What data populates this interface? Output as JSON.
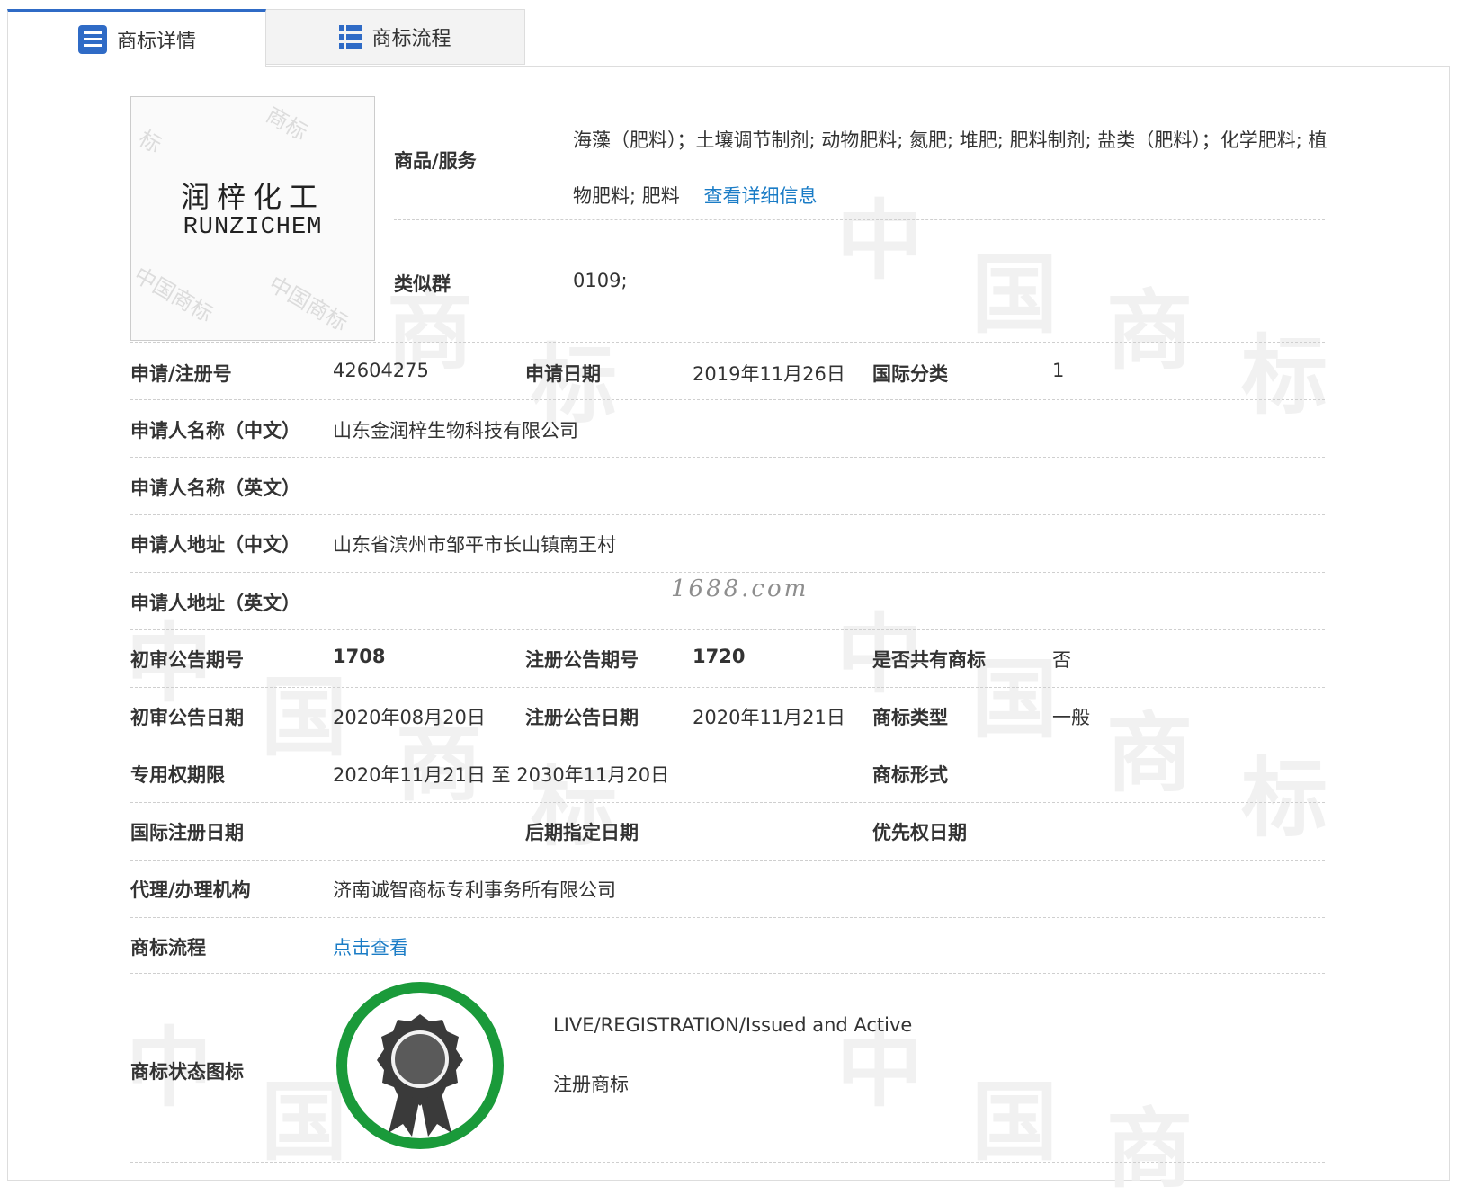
{
  "tabs": [
    {
      "label": "商标详情",
      "icon": "document-list-icon",
      "active": true
    },
    {
      "label": "商标流程",
      "icon": "grid-list-icon",
      "active": false
    }
  ],
  "logo": {
    "zh": "润梓化工",
    "en": "RUNZICHEM",
    "watermark": "中国商标"
  },
  "goods": {
    "label": "商品/服务",
    "text": "海藻（肥料）；土壤调节制剂; 动物肥料; 氮肥; 堆肥; 肥料制剂; 盐类（肥料）；化学肥料; 植物肥料; 肥料",
    "link": "查看详细信息"
  },
  "similar_group": {
    "label": "类似群",
    "value": "0109;"
  },
  "fields": {
    "reg_no": {
      "label": "申请/注册号",
      "value": "42604275"
    },
    "apply_date": {
      "label": "申请日期",
      "value": "2019年11月26日"
    },
    "intl_class": {
      "label": "国际分类",
      "value": "1"
    },
    "applicant_zh": {
      "label": "申请人名称（中文）",
      "value": "山东金润梓生物科技有限公司"
    },
    "applicant_en": {
      "label": "申请人名称（英文）",
      "value": ""
    },
    "address_zh": {
      "label": "申请人地址（中文）",
      "value": "山东省滨州市邹平市长山镇南王村"
    },
    "address_en": {
      "label": "申请人地址（英文）",
      "value": ""
    },
    "prelim_issue": {
      "label": "初审公告期号",
      "value": "1708"
    },
    "reg_issue": {
      "label": "注册公告期号",
      "value": "1720"
    },
    "shared": {
      "label": "是否共有商标",
      "value": "否"
    },
    "prelim_date": {
      "label": "初审公告日期",
      "value": "2020年08月20日"
    },
    "reg_date": {
      "label": "注册公告日期",
      "value": "2020年11月21日"
    },
    "tm_type": {
      "label": "商标类型",
      "value": "一般"
    },
    "term": {
      "label": "专用权期限",
      "value": "2020年11月21日 至 2030年11月20日"
    },
    "tm_form": {
      "label": "商标形式",
      "value": ""
    },
    "intl_reg_date": {
      "label": "国际注册日期",
      "value": ""
    },
    "later_date": {
      "label": "后期指定日期",
      "value": ""
    },
    "priority_date": {
      "label": "优先权日期",
      "value": ""
    },
    "agent": {
      "label": "代理/办理机构",
      "value": "济南诚智商标专利事务所有限公司"
    },
    "process": {
      "label": "商标流程",
      "link": "点击查看"
    }
  },
  "status": {
    "label": "商标状态图标",
    "icon": "registration-badge-icon",
    "line1": "LIVE/REGISTRATION/Issued and Active",
    "line2": "注册商标",
    "ring_color": "#1a9a3a"
  },
  "site_watermark": "1688.com",
  "colors": {
    "tab_accent": "#2f6bc6",
    "link": "#1a7cc6",
    "icon_blue": "#2f6bc6"
  }
}
